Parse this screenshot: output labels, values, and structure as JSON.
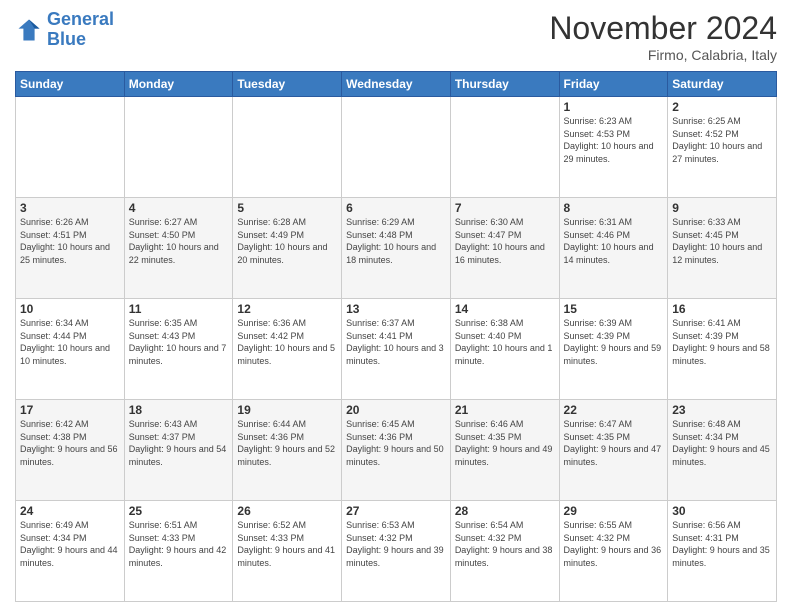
{
  "header": {
    "logo": {
      "line1": "General",
      "line2": "Blue"
    },
    "title": "November 2024",
    "location": "Firmo, Calabria, Italy"
  },
  "days_of_week": [
    "Sunday",
    "Monday",
    "Tuesday",
    "Wednesday",
    "Thursday",
    "Friday",
    "Saturday"
  ],
  "weeks": [
    [
      {
        "day": "",
        "info": ""
      },
      {
        "day": "",
        "info": ""
      },
      {
        "day": "",
        "info": ""
      },
      {
        "day": "",
        "info": ""
      },
      {
        "day": "",
        "info": ""
      },
      {
        "day": "1",
        "info": "Sunrise: 6:23 AM\nSunset: 4:53 PM\nDaylight: 10 hours and 29 minutes."
      },
      {
        "day": "2",
        "info": "Sunrise: 6:25 AM\nSunset: 4:52 PM\nDaylight: 10 hours and 27 minutes."
      }
    ],
    [
      {
        "day": "3",
        "info": "Sunrise: 6:26 AM\nSunset: 4:51 PM\nDaylight: 10 hours and 25 minutes."
      },
      {
        "day": "4",
        "info": "Sunrise: 6:27 AM\nSunset: 4:50 PM\nDaylight: 10 hours and 22 minutes."
      },
      {
        "day": "5",
        "info": "Sunrise: 6:28 AM\nSunset: 4:49 PM\nDaylight: 10 hours and 20 minutes."
      },
      {
        "day": "6",
        "info": "Sunrise: 6:29 AM\nSunset: 4:48 PM\nDaylight: 10 hours and 18 minutes."
      },
      {
        "day": "7",
        "info": "Sunrise: 6:30 AM\nSunset: 4:47 PM\nDaylight: 10 hours and 16 minutes."
      },
      {
        "day": "8",
        "info": "Sunrise: 6:31 AM\nSunset: 4:46 PM\nDaylight: 10 hours and 14 minutes."
      },
      {
        "day": "9",
        "info": "Sunrise: 6:33 AM\nSunset: 4:45 PM\nDaylight: 10 hours and 12 minutes."
      }
    ],
    [
      {
        "day": "10",
        "info": "Sunrise: 6:34 AM\nSunset: 4:44 PM\nDaylight: 10 hours and 10 minutes."
      },
      {
        "day": "11",
        "info": "Sunrise: 6:35 AM\nSunset: 4:43 PM\nDaylight: 10 hours and 7 minutes."
      },
      {
        "day": "12",
        "info": "Sunrise: 6:36 AM\nSunset: 4:42 PM\nDaylight: 10 hours and 5 minutes."
      },
      {
        "day": "13",
        "info": "Sunrise: 6:37 AM\nSunset: 4:41 PM\nDaylight: 10 hours and 3 minutes."
      },
      {
        "day": "14",
        "info": "Sunrise: 6:38 AM\nSunset: 4:40 PM\nDaylight: 10 hours and 1 minute."
      },
      {
        "day": "15",
        "info": "Sunrise: 6:39 AM\nSunset: 4:39 PM\nDaylight: 9 hours and 59 minutes."
      },
      {
        "day": "16",
        "info": "Sunrise: 6:41 AM\nSunset: 4:39 PM\nDaylight: 9 hours and 58 minutes."
      }
    ],
    [
      {
        "day": "17",
        "info": "Sunrise: 6:42 AM\nSunset: 4:38 PM\nDaylight: 9 hours and 56 minutes."
      },
      {
        "day": "18",
        "info": "Sunrise: 6:43 AM\nSunset: 4:37 PM\nDaylight: 9 hours and 54 minutes."
      },
      {
        "day": "19",
        "info": "Sunrise: 6:44 AM\nSunset: 4:36 PM\nDaylight: 9 hours and 52 minutes."
      },
      {
        "day": "20",
        "info": "Sunrise: 6:45 AM\nSunset: 4:36 PM\nDaylight: 9 hours and 50 minutes."
      },
      {
        "day": "21",
        "info": "Sunrise: 6:46 AM\nSunset: 4:35 PM\nDaylight: 9 hours and 49 minutes."
      },
      {
        "day": "22",
        "info": "Sunrise: 6:47 AM\nSunset: 4:35 PM\nDaylight: 9 hours and 47 minutes."
      },
      {
        "day": "23",
        "info": "Sunrise: 6:48 AM\nSunset: 4:34 PM\nDaylight: 9 hours and 45 minutes."
      }
    ],
    [
      {
        "day": "24",
        "info": "Sunrise: 6:49 AM\nSunset: 4:34 PM\nDaylight: 9 hours and 44 minutes."
      },
      {
        "day": "25",
        "info": "Sunrise: 6:51 AM\nSunset: 4:33 PM\nDaylight: 9 hours and 42 minutes."
      },
      {
        "day": "26",
        "info": "Sunrise: 6:52 AM\nSunset: 4:33 PM\nDaylight: 9 hours and 41 minutes."
      },
      {
        "day": "27",
        "info": "Sunrise: 6:53 AM\nSunset: 4:32 PM\nDaylight: 9 hours and 39 minutes."
      },
      {
        "day": "28",
        "info": "Sunrise: 6:54 AM\nSunset: 4:32 PM\nDaylight: 9 hours and 38 minutes."
      },
      {
        "day": "29",
        "info": "Sunrise: 6:55 AM\nSunset: 4:32 PM\nDaylight: 9 hours and 36 minutes."
      },
      {
        "day": "30",
        "info": "Sunrise: 6:56 AM\nSunset: 4:31 PM\nDaylight: 9 hours and 35 minutes."
      }
    ]
  ]
}
